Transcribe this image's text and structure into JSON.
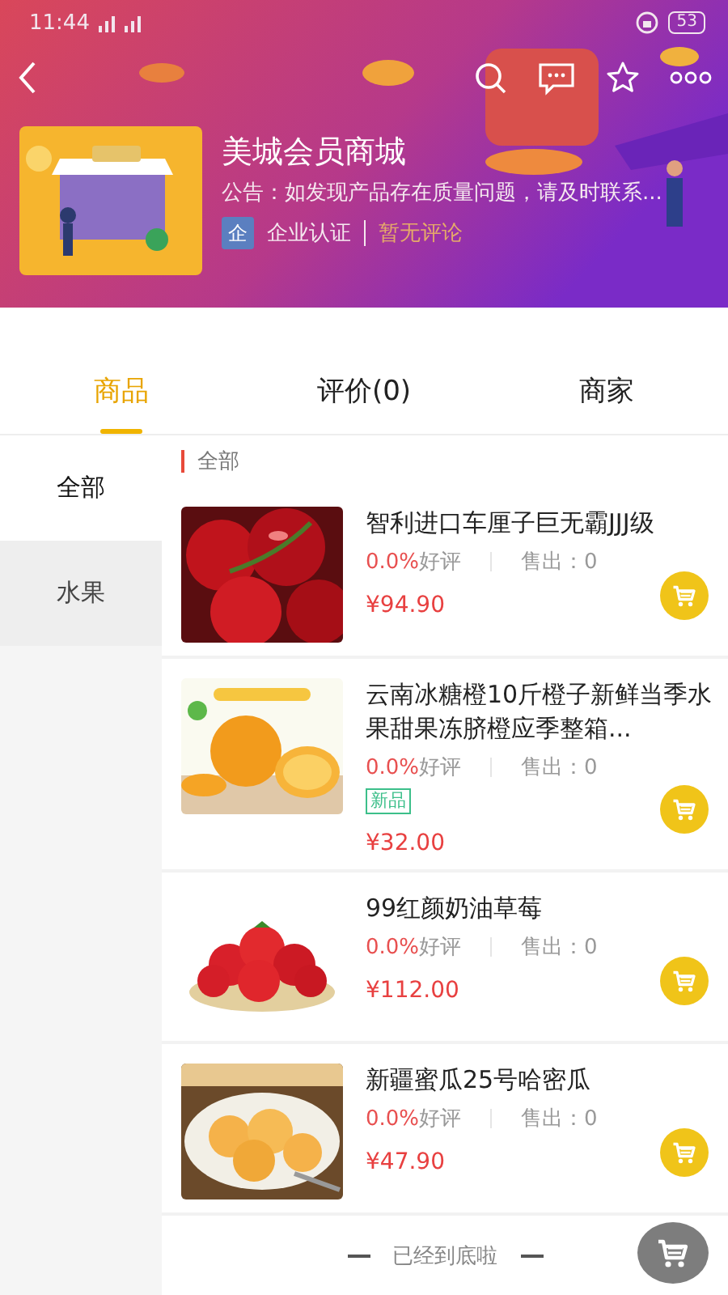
{
  "status_bar": {
    "time": "11:44",
    "battery": "53"
  },
  "shop": {
    "name": "美城会员商城",
    "notice": "公告：如发现产品存在质量问题，请及时联系...",
    "cert_icon": "企",
    "cert": "企业认证",
    "reviews": "暂无评论"
  },
  "tabs": [
    {
      "label": "商品",
      "selected": true
    },
    {
      "label": "评价(0)",
      "selected": false
    },
    {
      "label": "商家",
      "selected": false
    }
  ],
  "categories": [
    {
      "label": "全部",
      "selected": true
    },
    {
      "label": "水果",
      "selected": false
    }
  ],
  "section_title": "全部",
  "products": [
    {
      "name": "智利进口车厘子巨无霸JJJ级",
      "rating": "0.0%",
      "rating_label": "好评",
      "sold": "售出：0",
      "price": "¥94.90"
    },
    {
      "name": "云南冰糖橙10斤橙子新鲜当季水果甜果冻脐橙应季整箱...",
      "rating": "0.0%",
      "rating_label": "好评",
      "sold": "售出：0",
      "tag": "新品",
      "price": "¥32.00"
    },
    {
      "name": "99红颜奶油草莓",
      "rating": "0.0%",
      "rating_label": "好评",
      "sold": "售出：0",
      "price": "¥112.00"
    },
    {
      "name": "新疆蜜瓜25号哈密瓜",
      "rating": "0.0%",
      "rating_label": "好评",
      "sold": "售出：0",
      "price": "¥47.90"
    }
  ],
  "end_text": "已经到底啦"
}
